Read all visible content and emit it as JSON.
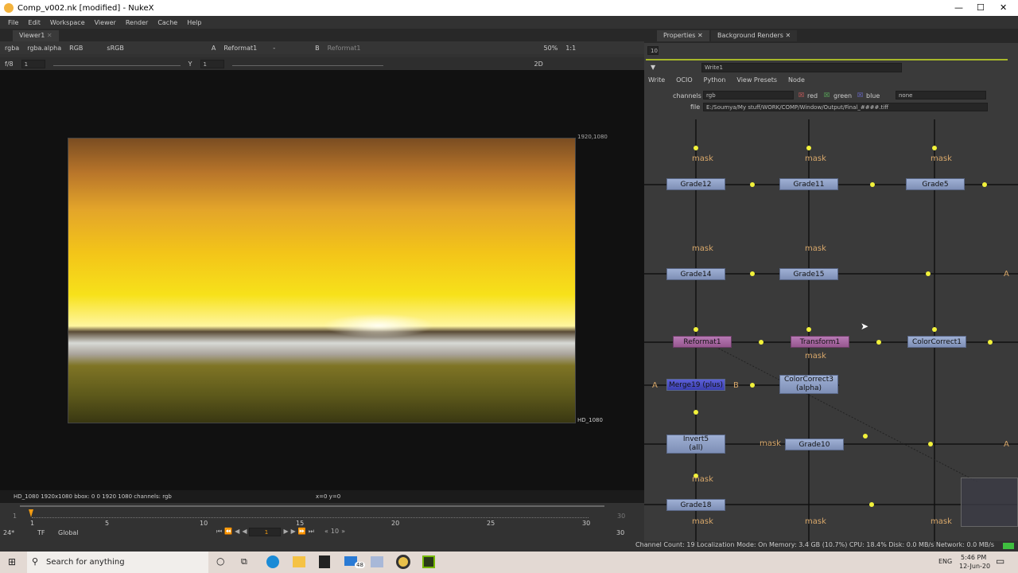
{
  "window": {
    "title": "Comp_v002.nk [modified] - NukeX",
    "min": "—",
    "max": "☐",
    "close": "✕"
  },
  "menu": [
    "File",
    "Edit",
    "Workspace",
    "Viewer",
    "Render",
    "Cache",
    "Help"
  ],
  "viewer": {
    "tab": "Viewer1",
    "channels": "rgba",
    "alpha": "rgba.alpha",
    "display": "RGB",
    "lut": "sRGB",
    "a_input": "Reformat1",
    "a_op": "-",
    "b_input": "Reformat1",
    "zoom": "50%",
    "ratio": "1:1",
    "fstop": "f/8",
    "gain": "1",
    "gamma_label": "Y",
    "gamma": "1",
    "mode": "2D",
    "format_top": "1920,1080",
    "format_bottom": "HD_1080",
    "info": "HD_1080 1920x1080  bbox: 0 0 1920 1080 channels: rgb",
    "coords": "x=0 y=0"
  },
  "timeline": {
    "start": "1",
    "end": "30",
    "ticks": [
      "1",
      "5",
      "10",
      "15",
      "20",
      "25",
      "30"
    ],
    "fps": "24*",
    "tf": "TF",
    "scope": "Global",
    "frame": "1",
    "step": "10",
    "end_field": "30"
  },
  "status": "Channel Count: 19 Localization Mode: On Memory: 3.4 GB (10.7%) CPU: 18.4% Disk: 0.0 MB/s Network: 0.0 MB/s",
  "properties": {
    "tabs": [
      "Properties",
      "Background Renders"
    ],
    "count": "10",
    "node_name": "Write1",
    "subtabs": [
      "Write",
      "OCIO",
      "Python",
      "View Presets",
      "Node"
    ],
    "channels_label": "channels",
    "channels": "rgb",
    "red": "red",
    "green": "green",
    "blue": "blue",
    "extra": "none",
    "file_label": "file",
    "file": "E:/Soumya/My stuff/WORK/COMP/Window/Output/Final_####.tiff"
  },
  "graph": {
    "nodes": [
      "Grade12",
      "Grade11",
      "Grade5",
      "Grade14",
      "Grade15",
      "Reformat1",
      "Transform1",
      "ColorCorrect1",
      "Merge19 (plus)",
      "ColorCorrect3\n(alpha)",
      "Invert5\n(all)",
      "Grade10",
      "Grade18"
    ],
    "mask": "mask",
    "a": "A",
    "b": "B"
  },
  "taskbar": {
    "search": "Search for anything",
    "lang": "ENG",
    "time": "5:46 PM",
    "date": "12-Jun-20",
    "mail_badge": "48"
  }
}
